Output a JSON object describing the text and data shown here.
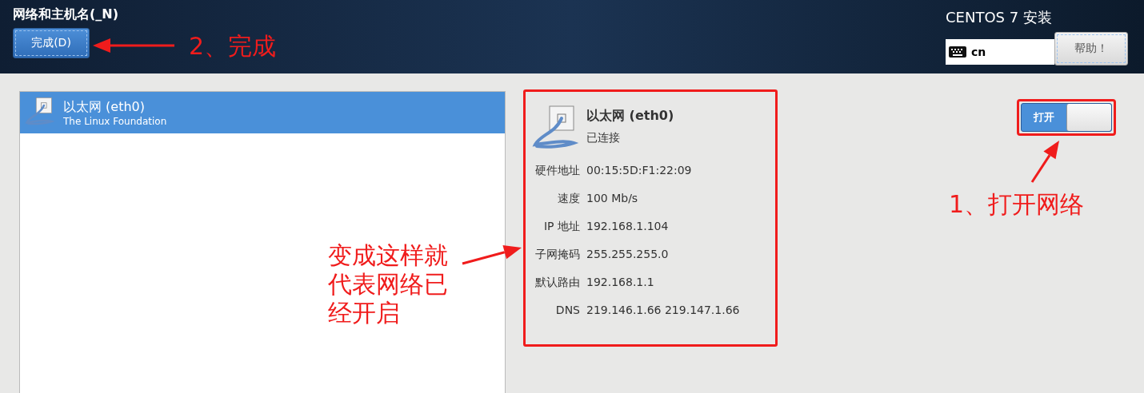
{
  "header": {
    "title": "网络和主机名(_N)",
    "done_button": "完成(D)",
    "product": "CENTOS 7 安装",
    "keyboard_layout": "cn",
    "help_button": "帮助！"
  },
  "devices": [
    {
      "name": "以太网 (eth0)",
      "vendor": "The Linux Foundation",
      "selected": true
    }
  ],
  "details": {
    "name": "以太网 (eth0)",
    "status": "已连接",
    "rows": [
      {
        "label": "硬件地址",
        "value": "00:15:5D:F1:22:09"
      },
      {
        "label": "速度",
        "value": "100 Mb/s"
      },
      {
        "label": "IP 地址",
        "value": "192.168.1.104"
      },
      {
        "label": "子网掩码",
        "value": "255.255.255.0"
      },
      {
        "label": "默认路由",
        "value": "192.168.1.1"
      },
      {
        "label": "DNS",
        "value": "219.146.1.66 219.147.1.66"
      }
    ]
  },
  "network_switch": {
    "label": "打开",
    "on": true
  },
  "annotations": [
    {
      "kind": "done",
      "text": "2、完成"
    },
    {
      "kind": "switch",
      "text": "1、打开网络"
    },
    {
      "kind": "details",
      "text": "变成这样就代表网络已经开启"
    }
  ]
}
